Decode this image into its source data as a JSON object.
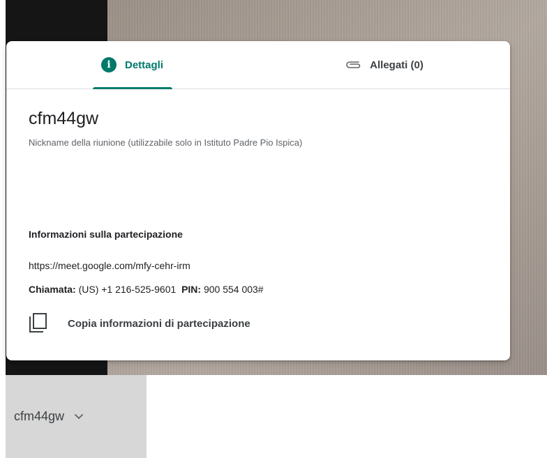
{
  "tabs": {
    "details_label": "Dettagli",
    "attachments_label": "Allegati (0)",
    "active_color": "#00796b"
  },
  "meeting": {
    "name": "cfm44gw",
    "nickname_note": "Nickname della riunione (utilizzabile solo in Istituto Padre Pio Ispica)"
  },
  "join_info": {
    "heading": "Informazioni sulla partecipazione",
    "url": "https://meet.google.com/mfy-cehr-irm",
    "phone_label": "Chiamata:",
    "phone_value": "(US) +1 216-525-9601",
    "pin_label": "PIN:",
    "pin_value": "900 554 003#",
    "copy_label": "Copia informazioni di partecipazione"
  },
  "bottom_chip": {
    "label": "cfm44gw"
  },
  "icons": {
    "details": "info-icon",
    "attachments": "paperclip-icon",
    "copy": "copy-icon",
    "chip": "chevron-down-icon"
  }
}
